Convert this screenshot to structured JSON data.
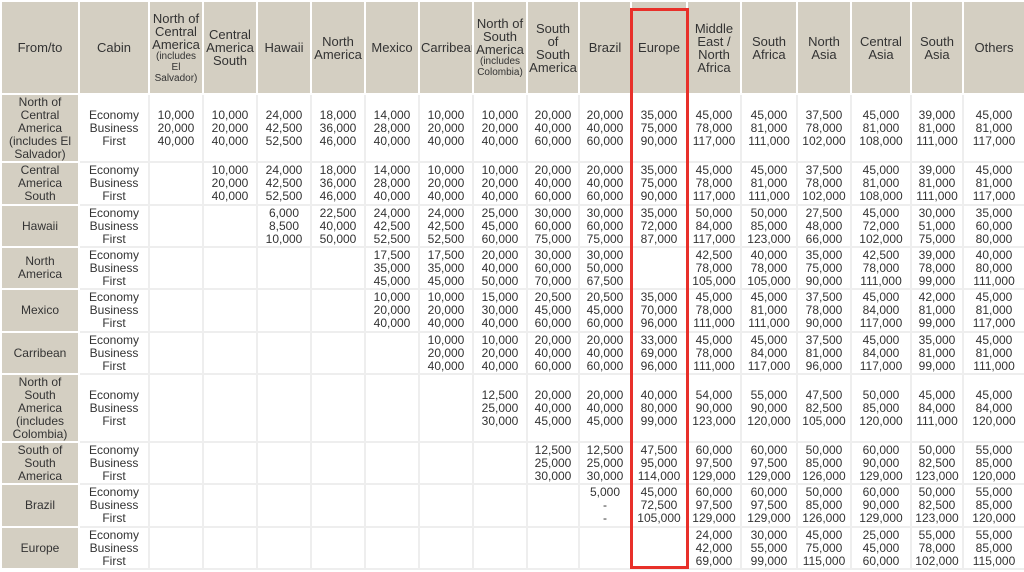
{
  "header": {
    "from_to": "From/to",
    "cabin": "Cabin",
    "columns": [
      {
        "label": "North of Central America",
        "sub": "(includes El Salvador)"
      },
      {
        "label": "Central America South",
        "sub": ""
      },
      {
        "label": "Hawaii",
        "sub": ""
      },
      {
        "label": "North America",
        "sub": ""
      },
      {
        "label": "Mexico",
        "sub": ""
      },
      {
        "label": "Carribean",
        "sub": ""
      },
      {
        "label": "North of South America",
        "sub": "(includes Colombia)"
      },
      {
        "label": "South of South America",
        "sub": ""
      },
      {
        "label": "Brazil",
        "sub": ""
      },
      {
        "label": "Europe",
        "sub": ""
      },
      {
        "label": "Middle East / North Africa",
        "sub": ""
      },
      {
        "label": "South Africa",
        "sub": ""
      },
      {
        "label": "North Asia",
        "sub": ""
      },
      {
        "label": "Central Asia",
        "sub": ""
      },
      {
        "label": "South Asia",
        "sub": ""
      },
      {
        "label": "Others",
        "sub": ""
      }
    ]
  },
  "highlight": {
    "column": "Europe",
    "color": "#e8302a"
  },
  "cabins": [
    "Economy",
    "Business",
    "First"
  ],
  "rows": [
    {
      "from": "North of Central America (includes El Salvador)",
      "cells": [
        [
          "10,000",
          "20,000",
          "40,000"
        ],
        [
          "10,000",
          "20,000",
          "40,000"
        ],
        [
          "24,000",
          "42,500",
          "52,500"
        ],
        [
          "18,000",
          "36,000",
          "46,000"
        ],
        [
          "14,000",
          "28,000",
          "40,000"
        ],
        [
          "10,000",
          "20,000",
          "40,000"
        ],
        [
          "10,000",
          "20,000",
          "40,000"
        ],
        [
          "20,000",
          "40,000",
          "60,000"
        ],
        [
          "20,000",
          "40,000",
          "60,000"
        ],
        [
          "35,000",
          "75,000",
          "90,000"
        ],
        [
          "45,000",
          "78,000",
          "117,000"
        ],
        [
          "45,000",
          "81,000",
          "111,000"
        ],
        [
          "37,500",
          "78,000",
          "102,000"
        ],
        [
          "45,000",
          "81,000",
          "108,000"
        ],
        [
          "39,000",
          "81,000",
          "111,000"
        ],
        [
          "45,000",
          "81,000",
          "117,000"
        ]
      ]
    },
    {
      "from": "Central America South",
      "cells": [
        [],
        [
          "10,000",
          "20,000",
          "40,000"
        ],
        [
          "24,000",
          "42,500",
          "52,500"
        ],
        [
          "18,000",
          "36,000",
          "46,000"
        ],
        [
          "14,000",
          "28,000",
          "40,000"
        ],
        [
          "10,000",
          "20,000",
          "40,000"
        ],
        [
          "10,000",
          "20,000",
          "40,000"
        ],
        [
          "20,000",
          "40,000",
          "60,000"
        ],
        [
          "20,000",
          "40,000",
          "60,000"
        ],
        [
          "35,000",
          "75,000",
          "90,000"
        ],
        [
          "45,000",
          "78,000",
          "117,000"
        ],
        [
          "45,000",
          "81,000",
          "111,000"
        ],
        [
          "37,500",
          "78,000",
          "102,000"
        ],
        [
          "45,000",
          "81,000",
          "108,000"
        ],
        [
          "39,000",
          "81,000",
          "111,000"
        ],
        [
          "45,000",
          "81,000",
          "117,000"
        ]
      ]
    },
    {
      "from": "Hawaii",
      "cells": [
        [],
        [],
        [
          "6,000",
          "8,500",
          "10,000"
        ],
        [
          "22,500",
          "40,000",
          "50,000"
        ],
        [
          "24,000",
          "42,500",
          "52,500"
        ],
        [
          "24,000",
          "42,500",
          "52,500"
        ],
        [
          "25,000",
          "45,000",
          "60,000"
        ],
        [
          "30,000",
          "60,000",
          "75,000"
        ],
        [
          "30,000",
          "60,000",
          "75,000"
        ],
        [
          "35,000",
          "72,000",
          "87,000"
        ],
        [
          "50,000",
          "84,000",
          "117,000"
        ],
        [
          "50,000",
          "85,000",
          "123,000"
        ],
        [
          "27,500",
          "48,000",
          "66,000"
        ],
        [
          "45,000",
          "72,000",
          "102,000"
        ],
        [
          "30,000",
          "51,000",
          "75,000"
        ],
        [
          "35,000",
          "60,000",
          "80,000"
        ]
      ]
    },
    {
      "from": "North America",
      "cells": [
        [],
        [],
        [],
        [],
        [
          "17,500",
          "35,000",
          "45,000"
        ],
        [
          "17,500",
          "35,000",
          "45,000"
        ],
        [
          "20,000",
          "40,000",
          "50,000"
        ],
        [
          "30,000",
          "60,000",
          "70,000"
        ],
        [
          "30,000",
          "50,000",
          "67,500"
        ],
        [],
        [
          "42,500",
          "78,000",
          "105,000"
        ],
        [
          "40,000",
          "78,000",
          "105,000"
        ],
        [
          "35,000",
          "75,000",
          "90,000"
        ],
        [
          "42,500",
          "78,000",
          "111,000"
        ],
        [
          "39,000",
          "78,000",
          "99,000"
        ],
        [
          "40,000",
          "80,000",
          "111,000"
        ]
      ]
    },
    {
      "from": "Mexico",
      "cells": [
        [],
        [],
        [],
        [],
        [
          "10,000",
          "20,000",
          "40,000"
        ],
        [
          "10,000",
          "20,000",
          "40,000"
        ],
        [
          "15,000",
          "30,000",
          "40,000"
        ],
        [
          "20,500",
          "45,000",
          "60,000"
        ],
        [
          "20,500",
          "45,000",
          "60,000"
        ],
        [
          "35,000",
          "70,000",
          "96,000"
        ],
        [
          "45,000",
          "78,000",
          "111,000"
        ],
        [
          "45,000",
          "81,000",
          "111,000"
        ],
        [
          "37,500",
          "78,000",
          "90,000"
        ],
        [
          "45,000",
          "84,000",
          "117,000"
        ],
        [
          "42,000",
          "81,000",
          "99,000"
        ],
        [
          "45,000",
          "81,000",
          "117,000"
        ]
      ]
    },
    {
      "from": "Carribean",
      "cells": [
        [],
        [],
        [],
        [],
        [],
        [
          "10,000",
          "20,000",
          "40,000"
        ],
        [
          "10,000",
          "20,000",
          "40,000"
        ],
        [
          "20,000",
          "40,000",
          "60,000"
        ],
        [
          "20,000",
          "40,000",
          "60,000"
        ],
        [
          "33,000",
          "69,000",
          "96,000"
        ],
        [
          "45,000",
          "78,000",
          "111,000"
        ],
        [
          "45,000",
          "84,000",
          "117,000"
        ],
        [
          "37,500",
          "81,000",
          "96,000"
        ],
        [
          "45,000",
          "84,000",
          "117,000"
        ],
        [
          "35,000",
          "81,000",
          "99,000"
        ],
        [
          "45,000",
          "81,000",
          "111,000"
        ]
      ]
    },
    {
      "from": "North of South America (includes Colombia)",
      "cells": [
        [],
        [],
        [],
        [],
        [],
        [],
        [
          "12,500",
          "25,000",
          "30,000"
        ],
        [
          "20,000",
          "40,000",
          "45,000"
        ],
        [
          "20,000",
          "40,000",
          "45,000"
        ],
        [
          "40,000",
          "80,000",
          "99,000"
        ],
        [
          "54,000",
          "90,000",
          "123,000"
        ],
        [
          "55,000",
          "90,000",
          "120,000"
        ],
        [
          "47,500",
          "82,500",
          "105,000"
        ],
        [
          "50,000",
          "85,000",
          "120,000"
        ],
        [
          "45,000",
          "84,000",
          "111,000"
        ],
        [
          "45,000",
          "84,000",
          "120,000"
        ]
      ]
    },
    {
      "from": "South of South America",
      "cells": [
        [],
        [],
        [],
        [],
        [],
        [],
        [],
        [
          "12,500",
          "25,000",
          "30,000"
        ],
        [
          "12,500",
          "25,000",
          "30,000"
        ],
        [
          "47,500",
          "95,000",
          "114,000"
        ],
        [
          "60,000",
          "97,500",
          "129,000"
        ],
        [
          "60,000",
          "97,500",
          "129,000"
        ],
        [
          "50,000",
          "85,000",
          "126,000"
        ],
        [
          "60,000",
          "90,000",
          "129,000"
        ],
        [
          "50,000",
          "82,500",
          "123,000"
        ],
        [
          "55,000",
          "85,000",
          "120,000"
        ]
      ]
    },
    {
      "from": "Brazil",
      "cells": [
        [],
        [],
        [],
        [],
        [],
        [],
        [],
        [],
        [
          "5,000",
          "-",
          "-"
        ],
        [
          "45,000",
          "72,500",
          "105,000"
        ],
        [
          "60,000",
          "97,500",
          "129,000"
        ],
        [
          "60,000",
          "97,500",
          "129,000"
        ],
        [
          "50,000",
          "85,000",
          "126,000"
        ],
        [
          "60,000",
          "90,000",
          "129,000"
        ],
        [
          "50,000",
          "82,500",
          "123,000"
        ],
        [
          "55,000",
          "85,000",
          "120,000"
        ]
      ]
    },
    {
      "from": "Europe",
      "cells": [
        [],
        [],
        [],
        [],
        [],
        [],
        [],
        [],
        [],
        [],
        [
          "24,000",
          "42,000",
          "69,000"
        ],
        [
          "30,000",
          "55,000",
          "99,000"
        ],
        [
          "45,000",
          "75,000",
          "115,000"
        ],
        [
          "25,000",
          "45,000",
          "60,000"
        ],
        [
          "55,000",
          "78,000",
          "102,000"
        ],
        [
          "55,000",
          "85,000",
          "115,000"
        ]
      ]
    }
  ]
}
